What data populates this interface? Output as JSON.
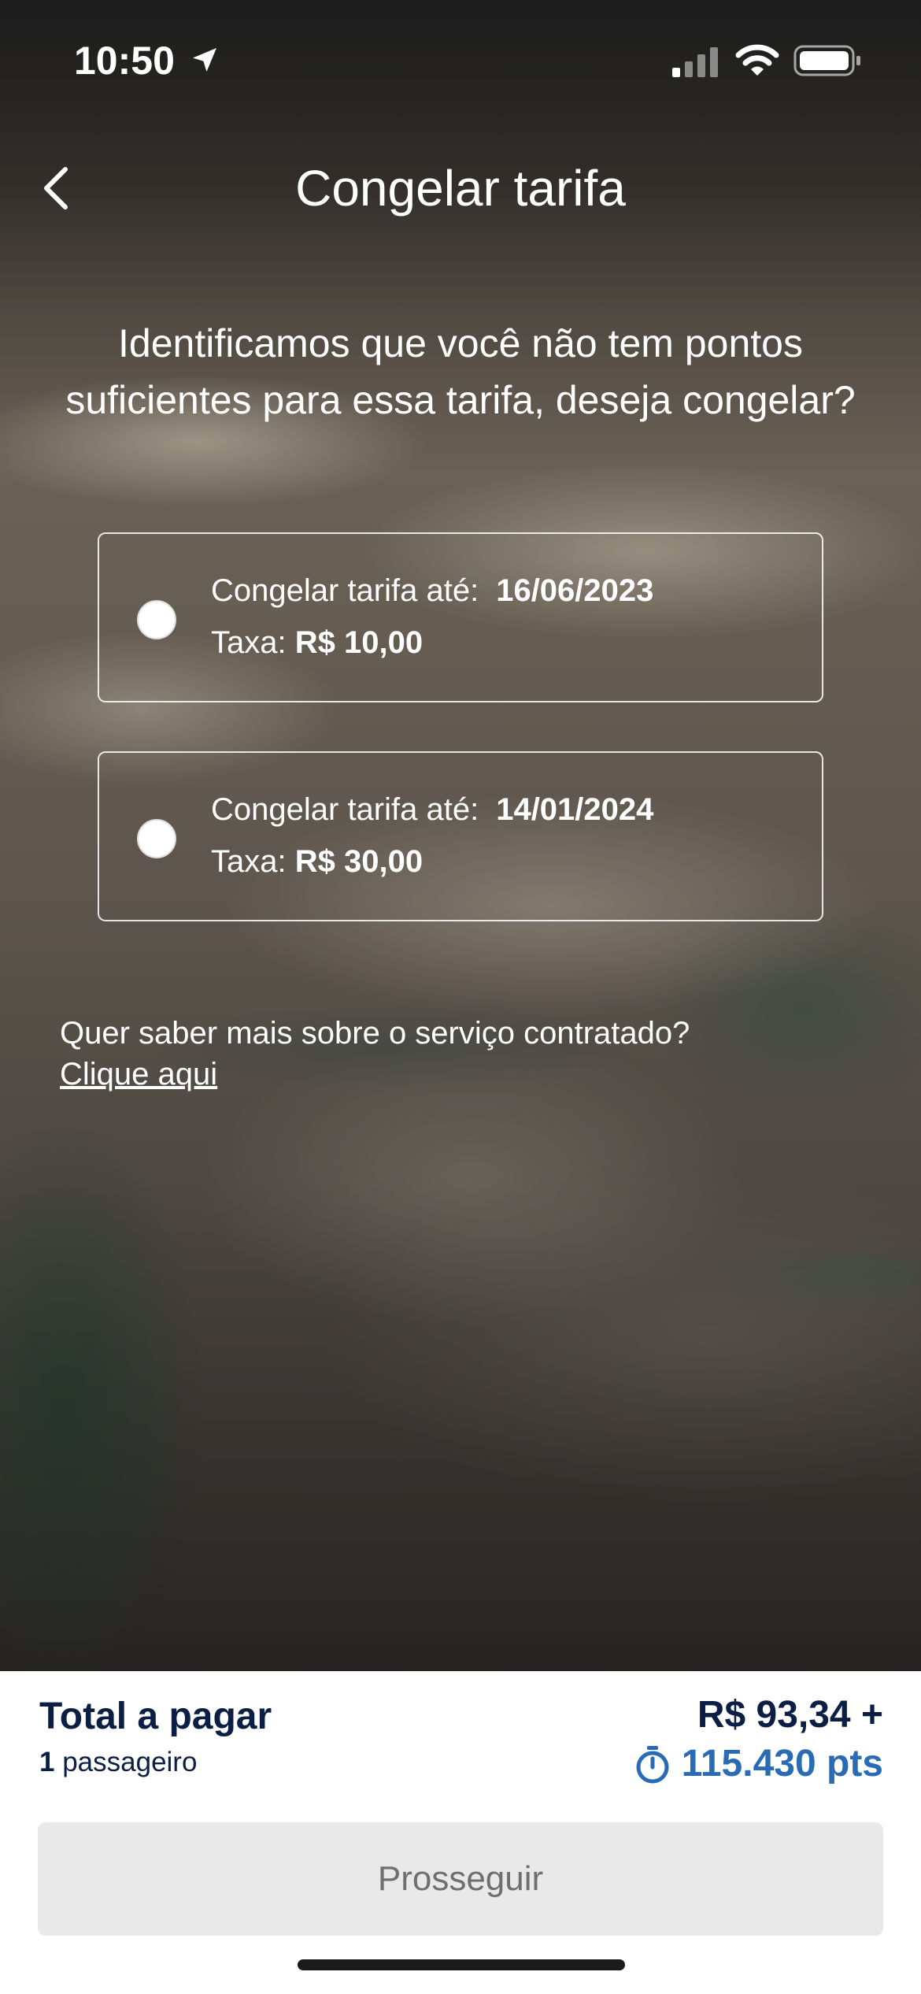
{
  "status_bar": {
    "time": "10:50"
  },
  "header": {
    "title": "Congelar tarifa"
  },
  "question": "Identificamos que você não tem pontos suficientes para essa tarifa, deseja congelar?",
  "options": [
    {
      "label": "Congelar tarifa até:",
      "date": "16/06/2023",
      "fee_label": "Taxa:",
      "fee_value": "R$ 10,00",
      "selected": false
    },
    {
      "label": "Congelar tarifa até:",
      "date": "14/01/2024",
      "fee_label": "Taxa:",
      "fee_value": "R$ 30,00",
      "selected": false
    }
  ],
  "info": {
    "question": "Quer saber mais sobre o serviço contratado?",
    "link": "Clique aqui"
  },
  "footer": {
    "total_label": "Total a pagar",
    "passenger_count": "1",
    "passenger_label": "passageiro",
    "price_money": "R$ 93,34 +",
    "price_points": "115.430 pts",
    "continue_label": "Prosseguir"
  },
  "colors": {
    "navy": "#0b1f44",
    "points_blue": "#2a6bb5",
    "button_disabled_bg": "#e9e9e9",
    "button_disabled_text": "#6f6f6f"
  },
  "icons": [
    "location-arrow-icon",
    "cell-signal-icon",
    "wifi-icon",
    "battery-icon",
    "chevron-left-icon",
    "timer-icon"
  ]
}
